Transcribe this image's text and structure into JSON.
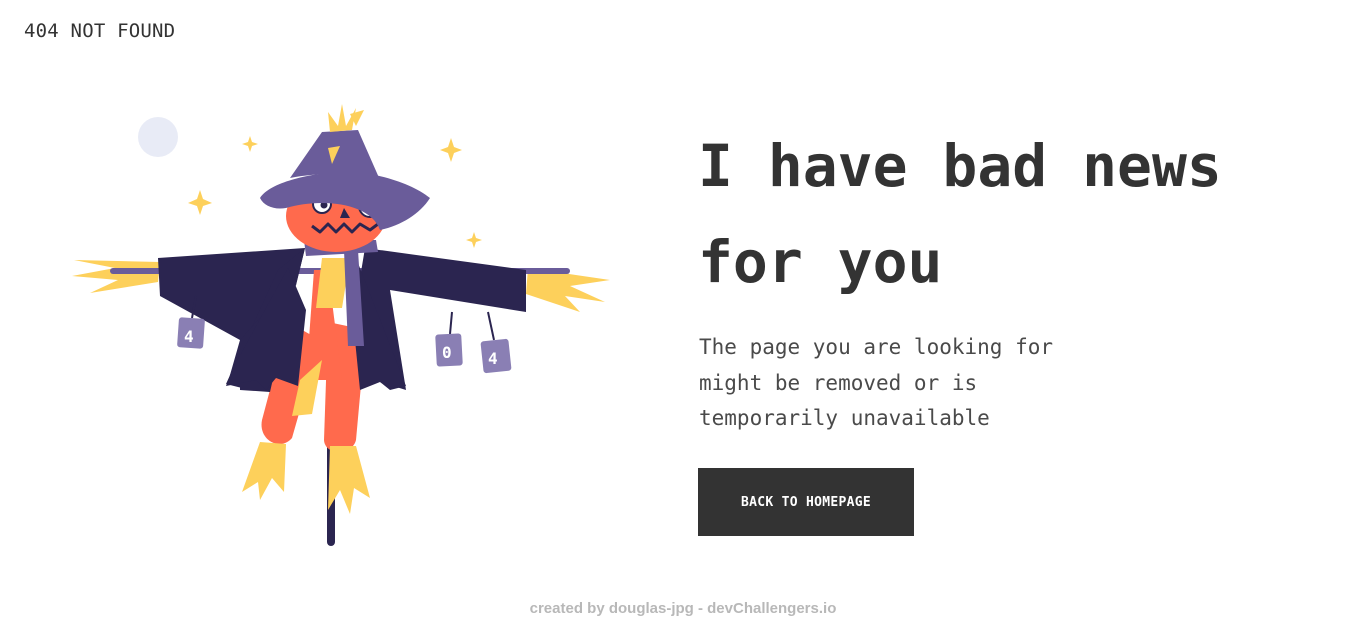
{
  "header": {
    "brand_text": "404 NOT FOUND"
  },
  "main": {
    "headline": "I have bad news for you",
    "message": "The page you are looking for might be removed or is temporarily unavailable",
    "cta_label": "BACK TO HOMEPAGE"
  },
  "illustration": {
    "name": "scarecrow-illustration",
    "can_labels": [
      "4",
      "0",
      "4"
    ]
  },
  "footer": {
    "credit": "created by douglas-jpg - devChallengers.io"
  },
  "colors": {
    "text": "#333333",
    "button_bg": "#333333",
    "button_text": "#ffffff",
    "footer_text": "#b8b8b8",
    "hat": "#6a5c9a",
    "coat": "#2b2550",
    "face": "#ff6a4d",
    "straw": "#fdd05b"
  }
}
